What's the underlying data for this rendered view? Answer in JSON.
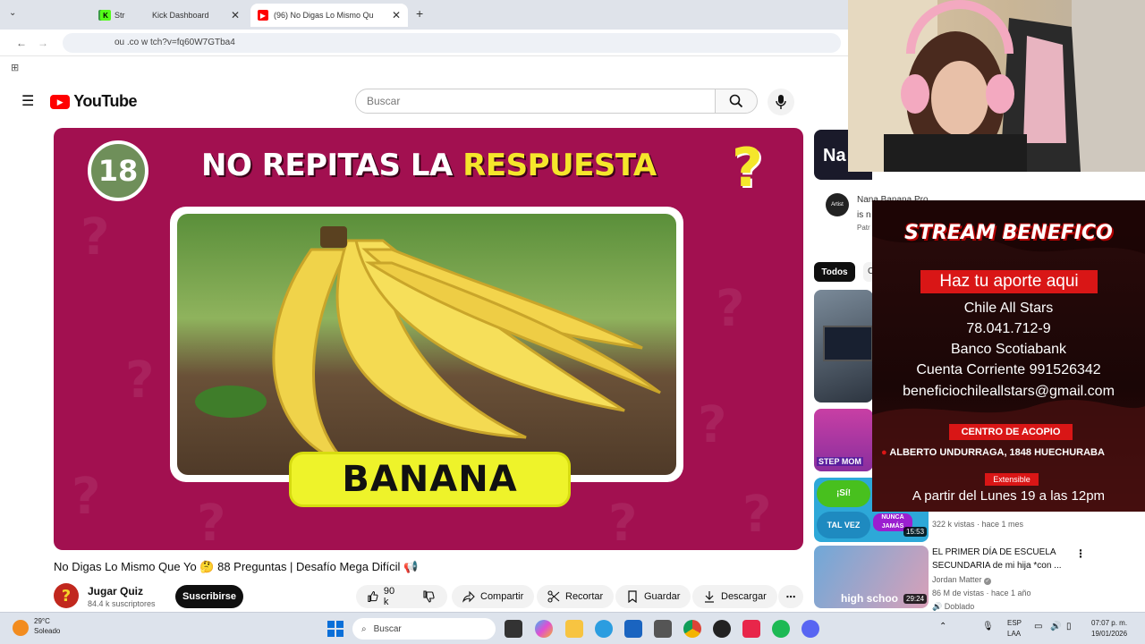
{
  "browser": {
    "tabs": [
      {
        "label": "Stre",
        "favicon": "green"
      },
      {
        "label": "Kick Dashboard",
        "favicon": "kick"
      },
      {
        "label": "(96) No Digas Lo Mismo Qu",
        "favicon": "youtube"
      }
    ],
    "url": "ou  .co   w  tch?v=fq60W7GTba4",
    "new_tab": "+"
  },
  "youtube": {
    "logo_text": "YouTube",
    "search_placeholder": "Buscar"
  },
  "video_frame": {
    "number": "18",
    "title_white": "NO REPITAS LA ",
    "title_yellow": "RESPUESTA",
    "answer": "BANANA"
  },
  "video": {
    "title": "No Digas Lo Mismo Que Yo 🤔 88 Preguntas | Desafío Mega Difícil 📢",
    "channel": "Jugar Quiz",
    "subscribers": "84.4 k suscriptores",
    "subscribe_label": "Suscribirse",
    "likes": "90 k",
    "share_label": "Compartir",
    "clip_label": "Recortar",
    "save_label": "Guardar",
    "download_label": "Descargar"
  },
  "sidebar": {
    "card_text": "Na",
    "artist_badge": "Artist",
    "channel_line1": "Nana Banana Pro",
    "channel_line2": "is n",
    "channel_line3": "Patr",
    "chip_all": "Todos",
    "chip_other": "C",
    "thumb2_label": "STEP MOM",
    "thumb3_top": "¡Sí!",
    "thumb3_bottom": "TAL VEZ",
    "thumb3_badge": "NUNCA JAMÁS",
    "thumb3_duration": "15:53",
    "thumb3_meta": "322 k vistas · hace 1 mes",
    "item4_title": "EL PRIMER DÍA DE ESCUELA SECUNDARIA de mi hija *con ...",
    "item4_channel": "Jordan Matter",
    "item4_meta": "86 M de vistas · hace 1 año",
    "item4_dubbed": "Doblado",
    "item4_duration": "29:24",
    "item4_thumb_text": "high schoo"
  },
  "overlay": {
    "title": "STREAM BENEFICO",
    "cta": "Haz tu aporte aqui",
    "lines": [
      "Chile All Stars",
      "78.041.712-9",
      "Banco Scotiabank",
      "Cuenta Corriente 991526342",
      "beneficiochileallstars@gmail.com"
    ],
    "acopio": "CENTRO DE ACOPIO",
    "address": "ALBERTO UNDURRAGA, 1848 HUECHURABA",
    "extensible": "Extensible",
    "date": "A partir del Lunes 19 a las 12pm"
  },
  "taskbar": {
    "temp": "29°C",
    "weather": "Soleado",
    "search": "Buscar",
    "lang1": "ESP",
    "lang2": "LAA",
    "time": "07:07 p. m.",
    "date": "19/01/2026"
  },
  "colors": {
    "video_bg": "#a21050",
    "yellow": "#f5e62b",
    "overlay_red": "#d91616"
  }
}
